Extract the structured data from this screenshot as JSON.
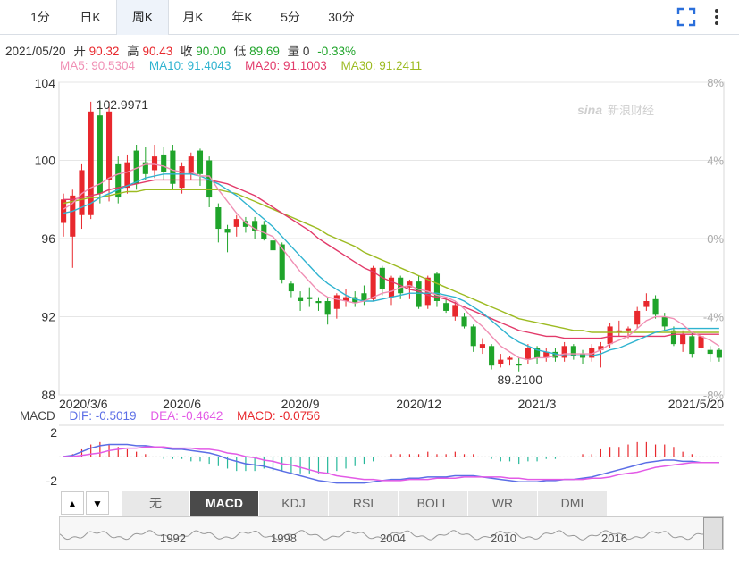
{
  "tabs": [
    {
      "label": "1分",
      "active": false
    },
    {
      "label": "日K",
      "active": false
    },
    {
      "label": "周K",
      "active": true
    },
    {
      "label": "月K",
      "active": false
    },
    {
      "label": "年K",
      "active": false
    },
    {
      "label": "5分",
      "active": false
    },
    {
      "label": "30分",
      "active": false
    }
  ],
  "icons": {
    "fullscreen": "fullscreen-icon",
    "more": "more-vertical-icon"
  },
  "info": {
    "date": "2021/05/20",
    "open_label": "开",
    "open": "90.32",
    "high_label": "高",
    "high": "90.43",
    "close_label": "收",
    "close": "90.00",
    "low_label": "低",
    "low": "89.69",
    "vol_label": "量",
    "vol": "0",
    "change": "-0.33%"
  },
  "ma": {
    "ma5": "MA5: 90.5304",
    "ma10": "MA10: 91.4043",
    "ma20": "MA20: 91.1003",
    "ma30": "MA30: 91.2411"
  },
  "macd_info": {
    "label": "MACD",
    "dif": "DIF: -0.5019",
    "dea": "DEA: -0.4642",
    "macd": "MACD: -0.0756"
  },
  "watermark": "新浪财经",
  "colors": {
    "up": "#e8282d",
    "down": "#1fa42a",
    "ma5": "#f08fb4",
    "ma10": "#2fb3d0",
    "ma20": "#e23a6a",
    "ma30": "#9dbb22",
    "dif": "#5b6ee6",
    "dea": "#e35ae6",
    "grid": "#e6e6e6",
    "text_up": "#e8282d",
    "text_down": "#1fa42a"
  },
  "chart_data": {
    "type": "candlestick",
    "price_ticks": [
      "104",
      "100",
      "96",
      "92",
      "88"
    ],
    "pct_ticks": [
      "8%",
      "4%",
      "0%",
      "-4%",
      "-8%"
    ],
    "x_ticks": [
      "2020/3/6",
      "2020/6",
      "2020/9",
      "2020/12",
      "2021/3",
      "2021/5/20"
    ],
    "high_annotation": "102.9971",
    "low_annotation": "89.2100",
    "ylim": [
      88,
      104
    ],
    "candles": [
      {
        "o": 96.8,
        "c": 98.0,
        "h": 98.3,
        "l": 96.1
      },
      {
        "o": 96.1,
        "c": 98.2,
        "h": 98.5,
        "l": 94.5
      },
      {
        "o": 97.2,
        "c": 99.5,
        "h": 99.8,
        "l": 96.5
      },
      {
        "o": 97.2,
        "c": 102.5,
        "h": 103.0,
        "l": 97.0
      },
      {
        "o": 102.3,
        "c": 98.3,
        "h": 103.0,
        "l": 97.8
      },
      {
        "o": 99.0,
        "c": 102.5,
        "h": 103.0,
        "l": 97.9
      },
      {
        "o": 99.8,
        "c": 98.1,
        "h": 100.2,
        "l": 97.8
      },
      {
        "o": 98.6,
        "c": 99.9,
        "h": 100.3,
        "l": 98.3
      },
      {
        "o": 100.5,
        "c": 98.8,
        "h": 100.8,
        "l": 98.5
      },
      {
        "o": 99.9,
        "c": 99.3,
        "h": 100.7,
        "l": 99.0
      },
      {
        "o": 99.5,
        "c": 100.2,
        "h": 100.8,
        "l": 99.1
      },
      {
        "o": 100.3,
        "c": 99.4,
        "h": 100.7,
        "l": 99.0
      },
      {
        "o": 100.5,
        "c": 98.8,
        "h": 100.8,
        "l": 98.5
      },
      {
        "o": 98.6,
        "c": 99.7,
        "h": 99.9,
        "l": 98.3
      },
      {
        "o": 99.3,
        "c": 100.2,
        "h": 100.4,
        "l": 99.0
      },
      {
        "o": 100.5,
        "c": 99.3,
        "h": 100.6,
        "l": 98.7
      },
      {
        "o": 100.0,
        "c": 98.1,
        "h": 100.2,
        "l": 97.6
      },
      {
        "o": 97.6,
        "c": 96.5,
        "h": 97.8,
        "l": 95.8
      },
      {
        "o": 96.5,
        "c": 96.3,
        "h": 96.7,
        "l": 95.3
      },
      {
        "o": 96.6,
        "c": 97.0,
        "h": 97.2,
        "l": 96.1
      },
      {
        "o": 96.9,
        "c": 96.6,
        "h": 97.1,
        "l": 96.3
      },
      {
        "o": 96.9,
        "c": 96.4,
        "h": 97.1,
        "l": 96.0
      },
      {
        "o": 96.7,
        "c": 96.0,
        "h": 96.9,
        "l": 95.9
      },
      {
        "o": 95.9,
        "c": 95.4,
        "h": 96.1,
        "l": 95.2
      },
      {
        "o": 95.7,
        "c": 93.9,
        "h": 95.8,
        "l": 93.7
      },
      {
        "o": 93.7,
        "c": 93.3,
        "h": 93.8,
        "l": 93.0
      },
      {
        "o": 93.0,
        "c": 92.8,
        "h": 93.3,
        "l": 92.3
      },
      {
        "o": 93.0,
        "c": 92.9,
        "h": 93.5,
        "l": 92.5
      },
      {
        "o": 92.8,
        "c": 92.7,
        "h": 93.0,
        "l": 92.3
      },
      {
        "o": 92.8,
        "c": 92.1,
        "h": 93.0,
        "l": 91.6
      },
      {
        "o": 92.4,
        "c": 93.1,
        "h": 93.2,
        "l": 91.9
      },
      {
        "o": 92.8,
        "c": 93.0,
        "h": 93.4,
        "l": 92.5
      },
      {
        "o": 93.0,
        "c": 92.7,
        "h": 93.3,
        "l": 92.5
      },
      {
        "o": 93.2,
        "c": 92.8,
        "h": 93.6,
        "l": 92.6
      },
      {
        "o": 92.9,
        "c": 94.5,
        "h": 94.6,
        "l": 92.8
      },
      {
        "o": 94.5,
        "c": 93.4,
        "h": 94.6,
        "l": 93.1
      },
      {
        "o": 93.0,
        "c": 94.0,
        "h": 94.1,
        "l": 92.6
      },
      {
        "o": 94.0,
        "c": 93.2,
        "h": 94.1,
        "l": 92.9
      },
      {
        "o": 93.5,
        "c": 93.8,
        "h": 93.9,
        "l": 92.9
      },
      {
        "o": 93.8,
        "c": 92.5,
        "h": 94.1,
        "l": 92.4
      },
      {
        "o": 92.6,
        "c": 94.0,
        "h": 94.1,
        "l": 92.4
      },
      {
        "o": 94.2,
        "c": 92.8,
        "h": 94.3,
        "l": 92.5
      },
      {
        "o": 92.7,
        "c": 92.3,
        "h": 92.9,
        "l": 92.2
      },
      {
        "o": 92.0,
        "c": 92.6,
        "h": 92.8,
        "l": 91.8
      },
      {
        "o": 92.0,
        "c": 91.5,
        "h": 92.2,
        "l": 91.4
      },
      {
        "o": 91.5,
        "c": 90.5,
        "h": 91.6,
        "l": 90.2
      },
      {
        "o": 90.4,
        "c": 90.6,
        "h": 90.9,
        "l": 90.1
      },
      {
        "o": 90.5,
        "c": 89.5,
        "h": 90.6,
        "l": 89.3
      },
      {
        "o": 89.6,
        "c": 89.8,
        "h": 90.1,
        "l": 89.4
      },
      {
        "o": 89.8,
        "c": 89.9,
        "h": 90.0,
        "l": 89.5
      },
      {
        "o": 89.6,
        "c": 89.5,
        "h": 89.9,
        "l": 89.2
      },
      {
        "o": 89.8,
        "c": 90.4,
        "h": 90.6,
        "l": 89.6
      },
      {
        "o": 90.4,
        "c": 89.9,
        "h": 90.5,
        "l": 89.6
      },
      {
        "o": 89.9,
        "c": 90.2,
        "h": 90.4,
        "l": 89.7
      },
      {
        "o": 90.2,
        "c": 89.9,
        "h": 90.4,
        "l": 89.7
      },
      {
        "o": 89.9,
        "c": 90.5,
        "h": 90.7,
        "l": 89.7
      },
      {
        "o": 90.5,
        "c": 90.0,
        "h": 90.6,
        "l": 89.8
      },
      {
        "o": 90.1,
        "c": 89.9,
        "h": 90.3,
        "l": 89.6
      },
      {
        "o": 89.9,
        "c": 90.4,
        "h": 90.6,
        "l": 89.7
      },
      {
        "o": 90.3,
        "c": 90.5,
        "h": 90.7,
        "l": 89.4
      },
      {
        "o": 90.6,
        "c": 91.5,
        "h": 91.7,
        "l": 90.4
      },
      {
        "o": 91.2,
        "c": 91.3,
        "h": 91.8,
        "l": 91.0
      },
      {
        "o": 91.3,
        "c": 91.4,
        "h": 91.5,
        "l": 90.9
      },
      {
        "o": 91.6,
        "c": 92.3,
        "h": 92.5,
        "l": 91.4
      },
      {
        "o": 92.5,
        "c": 92.8,
        "h": 93.2,
        "l": 92.3
      },
      {
        "o": 92.9,
        "c": 92.1,
        "h": 93.1,
        "l": 91.9
      },
      {
        "o": 92.0,
        "c": 91.5,
        "h": 92.2,
        "l": 91.3
      },
      {
        "o": 91.3,
        "c": 90.6,
        "h": 91.5,
        "l": 90.5
      },
      {
        "o": 90.6,
        "c": 91.1,
        "h": 91.3,
        "l": 90.2
      },
      {
        "o": 91.0,
        "c": 90.1,
        "h": 91.2,
        "l": 89.9
      },
      {
        "o": 90.4,
        "c": 91.0,
        "h": 91.2,
        "l": 90.2
      },
      {
        "o": 90.3,
        "c": 90.1,
        "h": 90.5,
        "l": 89.7
      },
      {
        "o": 90.3,
        "c": 89.9,
        "h": 90.4,
        "l": 89.7
      }
    ],
    "ma5": [
      97.5,
      97.8,
      98.3,
      98.6,
      98.8,
      99.1,
      99.3,
      99.4,
      99.6,
      99.8,
      99.8,
      99.7,
      99.5,
      99.4,
      99.4,
      99.2,
      99.2,
      98.5,
      97.9,
      97.3,
      96.8,
      96.5,
      96.3,
      96.1,
      95.5,
      94.9,
      94.3,
      93.8,
      93.3,
      93.0,
      92.9,
      92.8,
      92.7,
      92.8,
      93.0,
      93.2,
      93.3,
      93.5,
      93.6,
      93.4,
      93.3,
      93.1,
      93.0,
      92.8,
      92.4,
      91.9,
      91.5,
      91.0,
      90.5,
      90.2,
      89.9,
      89.8,
      89.9,
      89.9,
      90.0,
      90.1,
      90.1,
      90.1,
      90.1,
      90.3,
      90.6,
      90.8,
      91.0,
      91.4,
      91.8,
      92.0,
      92.0,
      91.9,
      91.6,
      91.2,
      91.0,
      90.8,
      90.5
    ],
    "ma10": [
      97.3,
      97.4,
      97.6,
      97.8,
      98.1,
      98.3,
      98.5,
      98.7,
      98.9,
      99.1,
      99.2,
      99.3,
      99.3,
      99.3,
      99.3,
      99.2,
      99.0,
      98.8,
      98.5,
      98.2,
      97.8,
      97.4,
      97.0,
      96.6,
      96.1,
      95.6,
      95.1,
      94.6,
      94.1,
      93.7,
      93.4,
      93.1,
      92.9,
      92.8,
      92.8,
      92.9,
      93.0,
      93.1,
      93.2,
      93.2,
      93.2,
      93.2,
      93.1,
      93.0,
      92.8,
      92.5,
      92.2,
      91.8,
      91.4,
      91.0,
      90.7,
      90.5,
      90.3,
      90.2,
      90.1,
      90.0,
      90.0,
      90.0,
      90.0,
      90.1,
      90.3,
      90.4,
      90.6,
      90.8,
      91.0,
      91.2,
      91.3,
      91.4,
      91.4,
      91.4,
      91.4,
      91.4,
      91.4
    ],
    "ma20": [
      98.0,
      98.0,
      98.1,
      98.2,
      98.3,
      98.5,
      98.6,
      98.7,
      98.8,
      98.9,
      99.0,
      99.0,
      99.0,
      99.0,
      99.0,
      99.0,
      99.0,
      98.9,
      98.8,
      98.6,
      98.4,
      98.2,
      97.9,
      97.6,
      97.3,
      97.0,
      96.7,
      96.4,
      96.0,
      95.7,
      95.4,
      95.1,
      94.8,
      94.5,
      94.3,
      94.0,
      93.8,
      93.6,
      93.4,
      93.3,
      93.1,
      93.0,
      92.9,
      92.7,
      92.5,
      92.3,
      92.1,
      91.9,
      91.7,
      91.5,
      91.3,
      91.2,
      91.1,
      91.0,
      91.0,
      90.9,
      90.9,
      90.9,
      90.9,
      90.9,
      91.0,
      91.0,
      91.0,
      91.0,
      91.0,
      91.0,
      91.0,
      91.1,
      91.1,
      91.1,
      91.1,
      91.1,
      91.1
    ],
    "ma30": [
      97.8,
      97.9,
      98.0,
      98.1,
      98.1,
      98.2,
      98.3,
      98.4,
      98.4,
      98.5,
      98.5,
      98.5,
      98.5,
      98.5,
      98.5,
      98.5,
      98.5,
      98.5,
      98.4,
      98.3,
      98.1,
      97.9,
      97.7,
      97.5,
      97.3,
      97.1,
      96.9,
      96.7,
      96.5,
      96.2,
      96.0,
      95.8,
      95.6,
      95.3,
      95.1,
      94.9,
      94.7,
      94.5,
      94.3,
      94.1,
      93.9,
      93.7,
      93.5,
      93.3,
      93.1,
      92.9,
      92.7,
      92.5,
      92.3,
      92.1,
      91.9,
      91.8,
      91.7,
      91.6,
      91.5,
      91.4,
      91.3,
      91.3,
      91.2,
      91.2,
      91.2,
      91.2,
      91.2,
      91.2,
      91.2,
      91.2,
      91.2,
      91.2,
      91.2,
      91.2,
      91.2,
      91.2,
      91.2
    ],
    "macd_ticks": [
      "2",
      "-2"
    ],
    "macd_ylim": [
      -2.6,
      2.6
    ],
    "dif": [
      0.0,
      0.1,
      0.4,
      0.7,
      0.9,
      1.0,
      1.0,
      1.0,
      0.9,
      0.9,
      0.8,
      0.7,
      0.6,
      0.6,
      0.5,
      0.4,
      0.3,
      0.1,
      -0.2,
      -0.4,
      -0.6,
      -0.7,
      -0.8,
      -1.0,
      -1.2,
      -1.4,
      -1.6,
      -1.8,
      -2.0,
      -2.1,
      -2.2,
      -2.2,
      -2.2,
      -2.2,
      -2.1,
      -2.0,
      -1.9,
      -1.9,
      -1.8,
      -1.8,
      -1.7,
      -1.7,
      -1.7,
      -1.6,
      -1.6,
      -1.6,
      -1.7,
      -1.8,
      -1.9,
      -2.0,
      -2.1,
      -2.1,
      -2.1,
      -2.0,
      -2.0,
      -1.9,
      -1.9,
      -1.8,
      -1.7,
      -1.5,
      -1.3,
      -1.1,
      -0.9,
      -0.7,
      -0.5,
      -0.4,
      -0.3,
      -0.3,
      -0.4,
      -0.4,
      -0.5,
      -0.5,
      -0.5
    ],
    "dea": [
      0.0,
      0.0,
      0.1,
      0.2,
      0.3,
      0.5,
      0.6,
      0.7,
      0.7,
      0.8,
      0.8,
      0.8,
      0.7,
      0.7,
      0.7,
      0.6,
      0.6,
      0.5,
      0.3,
      0.2,
      0.0,
      -0.1,
      -0.3,
      -0.4,
      -0.6,
      -0.7,
      -0.9,
      -1.1,
      -1.3,
      -1.4,
      -1.6,
      -1.7,
      -1.8,
      -1.9,
      -1.9,
      -2.0,
      -2.0,
      -2.0,
      -1.9,
      -1.9,
      -1.9,
      -1.8,
      -1.8,
      -1.8,
      -1.7,
      -1.7,
      -1.7,
      -1.7,
      -1.7,
      -1.8,
      -1.8,
      -1.9,
      -1.9,
      -1.9,
      -1.9,
      -1.9,
      -1.9,
      -1.9,
      -1.8,
      -1.8,
      -1.7,
      -1.5,
      -1.4,
      -1.3,
      -1.1,
      -0.9,
      -0.8,
      -0.7,
      -0.6,
      -0.5,
      -0.5,
      -0.5,
      -0.5
    ],
    "nav_years": [
      "1992",
      "1998",
      "2004",
      "2010",
      "2016"
    ]
  },
  "indicator_tabs": [
    {
      "label": "无",
      "active": false
    },
    {
      "label": "MACD",
      "active": true
    },
    {
      "label": "KDJ",
      "active": false
    },
    {
      "label": "RSI",
      "active": false
    },
    {
      "label": "BOLL",
      "active": false
    },
    {
      "label": "WR",
      "active": false
    },
    {
      "label": "DMI",
      "active": false
    }
  ],
  "arrows": {
    "up": "▲",
    "down": "▼"
  }
}
